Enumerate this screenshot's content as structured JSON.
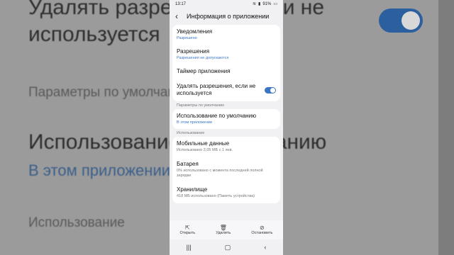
{
  "background": {
    "line1": "Удалять разрешения, если не",
    "line2": "используется",
    "line3": "Параметры по умолчанию",
    "line4": "Использование по умолчанию",
    "line5": "В этом приложении",
    "line6": "Использование"
  },
  "status": {
    "time": "13:17",
    "extra": "◂ ◂ ▪ ▪ ▪ •",
    "battery": "91%"
  },
  "header": {
    "title": "Информация о приложении"
  },
  "items": {
    "notifications": {
      "label": "Уведомления",
      "sub": "Разрешено"
    },
    "permissions": {
      "label": "Разрешения",
      "sub": "Разрешения не допускаются"
    },
    "timer": {
      "label": "Таймер приложения"
    },
    "remove_perms": {
      "label": "Удалять разрешения, если не используется",
      "toggle": "on"
    },
    "section_defaults": "Параметры по умолчанию",
    "default_use": {
      "label": "Использование по умолчанию",
      "sub": "В этом приложении"
    },
    "section_usage": "Использование",
    "mobile_data": {
      "label": "Мобильные данные",
      "sub": "Использовано 2,05 МБ с 1 янв."
    },
    "battery": {
      "label": "Батарея",
      "sub": "0% использовано с момента последней полной зарядки"
    },
    "storage": {
      "label": "Хранилище",
      "sub": "418 МБ использовано (Память устройства)"
    }
  },
  "actions": {
    "open": "Открыть",
    "delete": "Удалить",
    "stop": "Остановить"
  },
  "colors": {
    "accent": "#3b76c4"
  }
}
